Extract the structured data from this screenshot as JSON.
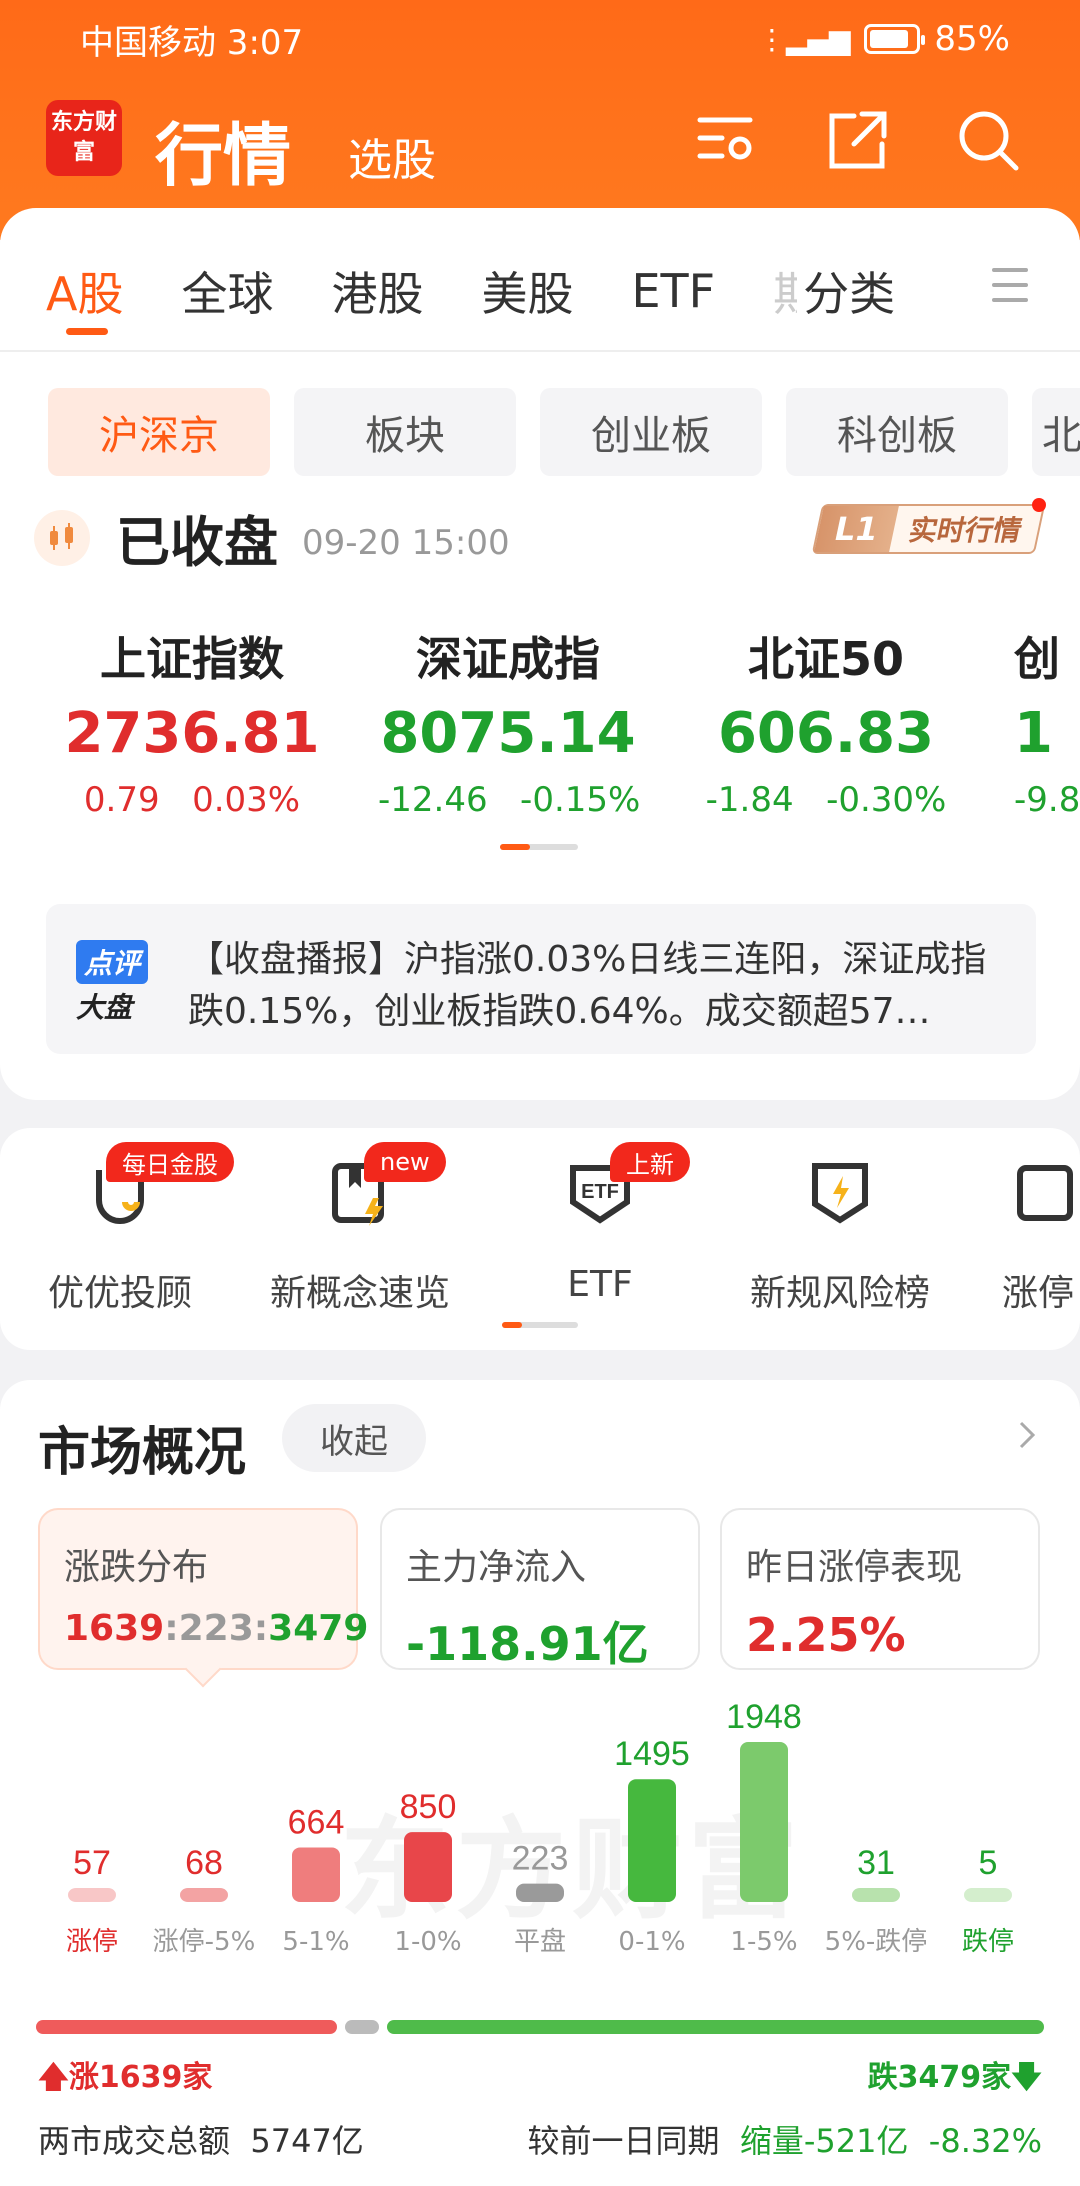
{
  "status": {
    "carrier": "中国移动 3:07",
    "battery": "85%",
    "battery_level": 0.85
  },
  "header": {
    "logo": "东方财富",
    "title": "行情",
    "subtitle": "选股"
  },
  "tabs": [
    "A股",
    "全球",
    "港股",
    "美股",
    "ETF",
    "期",
    "分类"
  ],
  "pills": [
    "沪深京",
    "板块",
    "创业板",
    "科创板",
    "北"
  ],
  "market": {
    "state": "已收盘",
    "time": "09-20 15:00",
    "l1": "L1",
    "l1_label": "实时行情"
  },
  "indices": [
    {
      "name": "上证指数",
      "value": "2736.81",
      "change": "0.79",
      "pct": "0.03%",
      "dir": "up"
    },
    {
      "name": "深证成指",
      "value": "8075.14",
      "change": "-12.46",
      "pct": "-0.15%",
      "dir": "down"
    },
    {
      "name": "北证50",
      "value": "606.83",
      "change": "-1.84",
      "pct": "-0.30%",
      "dir": "down"
    },
    {
      "name": "创",
      "value": "1",
      "change": "-9.8",
      "pct": "",
      "dir": "down"
    }
  ],
  "news": {
    "badge1": "点评",
    "badge2": "大盘",
    "text": "【收盘播报】沪指涨0.03%日线三连阳，深证成指跌0.15%，创业板指跌0.64%。成交额超57…"
  },
  "tools": [
    {
      "label": "优优投顾",
      "tag": "每日金股"
    },
    {
      "label": "新概念速览",
      "tag": "new"
    },
    {
      "label": "ETF",
      "tag": "上新"
    },
    {
      "label": "新规风险榜",
      "tag": ""
    },
    {
      "label": "涨停",
      "tag": ""
    }
  ],
  "overview": {
    "title": "市场概况",
    "collapse": "收起",
    "boxes": [
      {
        "title": "涨跌分布",
        "up": "1639",
        "flat": "223",
        "down": "3479"
      },
      {
        "title": "主力净流入",
        "value": "-118.91亿"
      },
      {
        "title": "昨日涨停表现",
        "value": "2.25%"
      }
    ],
    "watermark": "东方财富",
    "up_label": "涨1639家",
    "down_label": "跌3479家",
    "turnover_label": "两市成交总额",
    "turnover": "5747亿",
    "compare_label": "较前一日同期",
    "compare_value": "缩量-521亿",
    "compare_pct": "-8.32%"
  },
  "chart_data": {
    "type": "bar",
    "categories": [
      "涨停",
      "涨停-5%",
      "5-1%",
      "1-0%",
      "平盘",
      "0-1%",
      "1-5%",
      "5%-跌停",
      "跌停"
    ],
    "values": [
      57,
      68,
      664,
      850,
      223,
      1495,
      1948,
      31,
      5
    ],
    "colors": [
      "#f8c7c7",
      "#f3a3a3",
      "#ef7d7d",
      "#e8464a",
      "#9a9a9a",
      "#46b83e",
      "#7cca6c",
      "#b8e2ad",
      "#d4eecd"
    ]
  },
  "colors": {
    "brand": "#ff6a18",
    "up": "#e02d2d",
    "down": "#1fa12e",
    "accent": "#ff5a14"
  }
}
